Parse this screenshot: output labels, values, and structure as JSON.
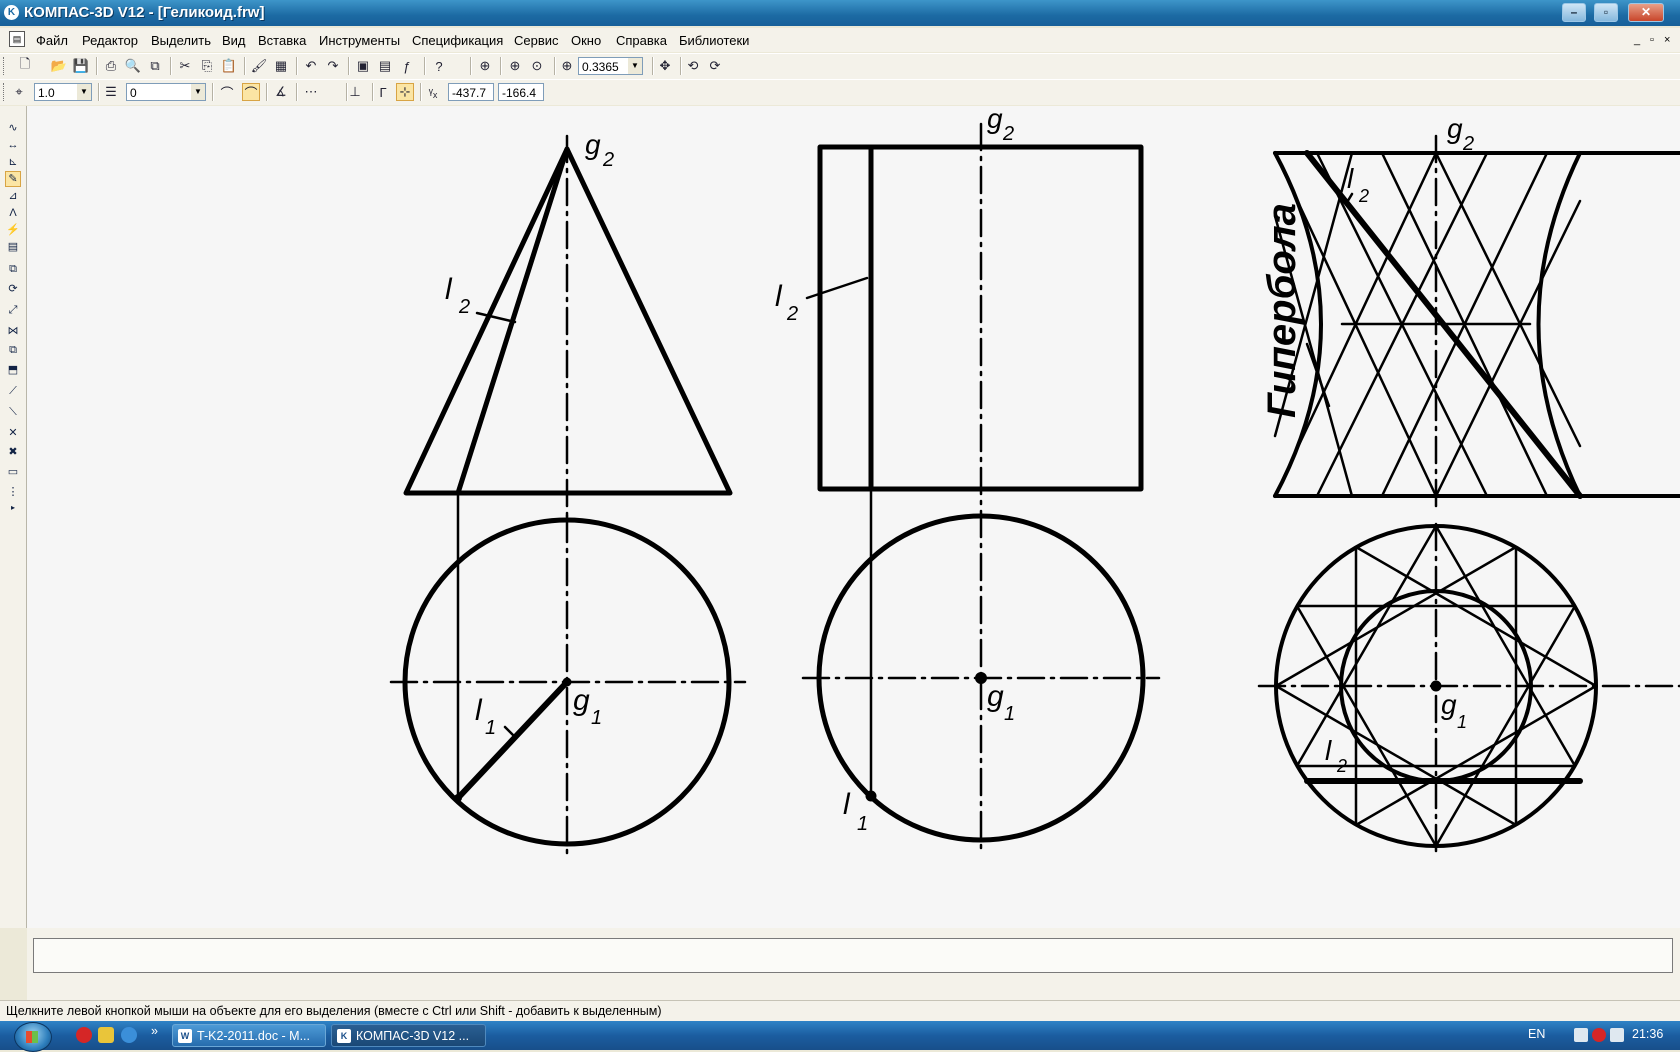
{
  "window": {
    "title": "КОМПАС-3D V12 - [Геликоид.frw]",
    "app_icon": "kompas-logo-icon",
    "controls": [
      "minimize-icon",
      "maximize-icon",
      "close-icon"
    ]
  },
  "menu": {
    "items": [
      "Файл",
      "Редактор",
      "Выделить",
      "Вид",
      "Вставка",
      "Инструменты",
      "Спецификация",
      "Сервис",
      "Окно",
      "Справка",
      "Библиотеки"
    ],
    "doc_controls": [
      "_",
      "▫",
      "×"
    ]
  },
  "toolbar": {
    "zoom_value": "0.3365",
    "step_value": "1.0",
    "layer_value": "0",
    "coord_x": "-437.7",
    "coord_y": "-166.4"
  },
  "drawing": {
    "labels": {
      "g2": "g",
      "g2_sub": "2",
      "l2": "l",
      "l2_sub": "2",
      "g1": "g",
      "g1_sub": "1",
      "l1": "l",
      "l1_sub": "1"
    },
    "hyperbola_label": "Гипербола"
  },
  "status": {
    "hint": "Щелкните левой кнопкой мыши на объекте для его выделения (вместе с Ctrl или Shift - добавить к выделенным)"
  },
  "taskbar": {
    "tasks": [
      {
        "label": "T-K2-2011.doc - M...",
        "icon": "word-doc-icon"
      },
      {
        "label": "КОМПАС-3D V12 ...",
        "icon": "kompas-logo-icon"
      }
    ],
    "language": "EN",
    "clock": "21:36",
    "overflow": "»"
  },
  "colors": {
    "titlebar": "#1c6aa3",
    "canvas": "#f6f6f6",
    "taskbar": "#1b5da0",
    "toolbar_active": "#fbe5a4"
  }
}
